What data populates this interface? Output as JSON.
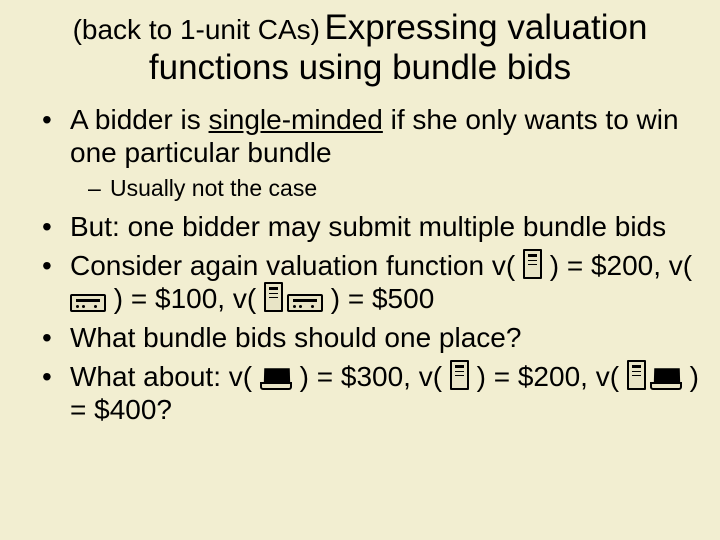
{
  "title": {
    "prefix": "(back to 1-unit CAs)",
    "main_line1": "Expressing valuation",
    "main_line2": "functions using bundle bids"
  },
  "bullets": {
    "b1_a": "A bidder is ",
    "b1_u": "single-minded",
    "b1_b": " if she only wants to win one particular bundle",
    "b1_sub": "Usually not the case",
    "b2": "But: one bidder may submit multiple bundle bids",
    "b3_a": "Consider again valuation function v( ",
    "b3_b": " ) = $200, v( ",
    "b3_c": " ) = $100, v( ",
    "b3_d": " ) = $500",
    "b4": "What bundle bids should one place?",
    "b5_a": "What about: v( ",
    "b5_b": " ) = $300, v( ",
    "b5_c": " ) = $200, v( ",
    "b5_d": " ) = $400?"
  }
}
